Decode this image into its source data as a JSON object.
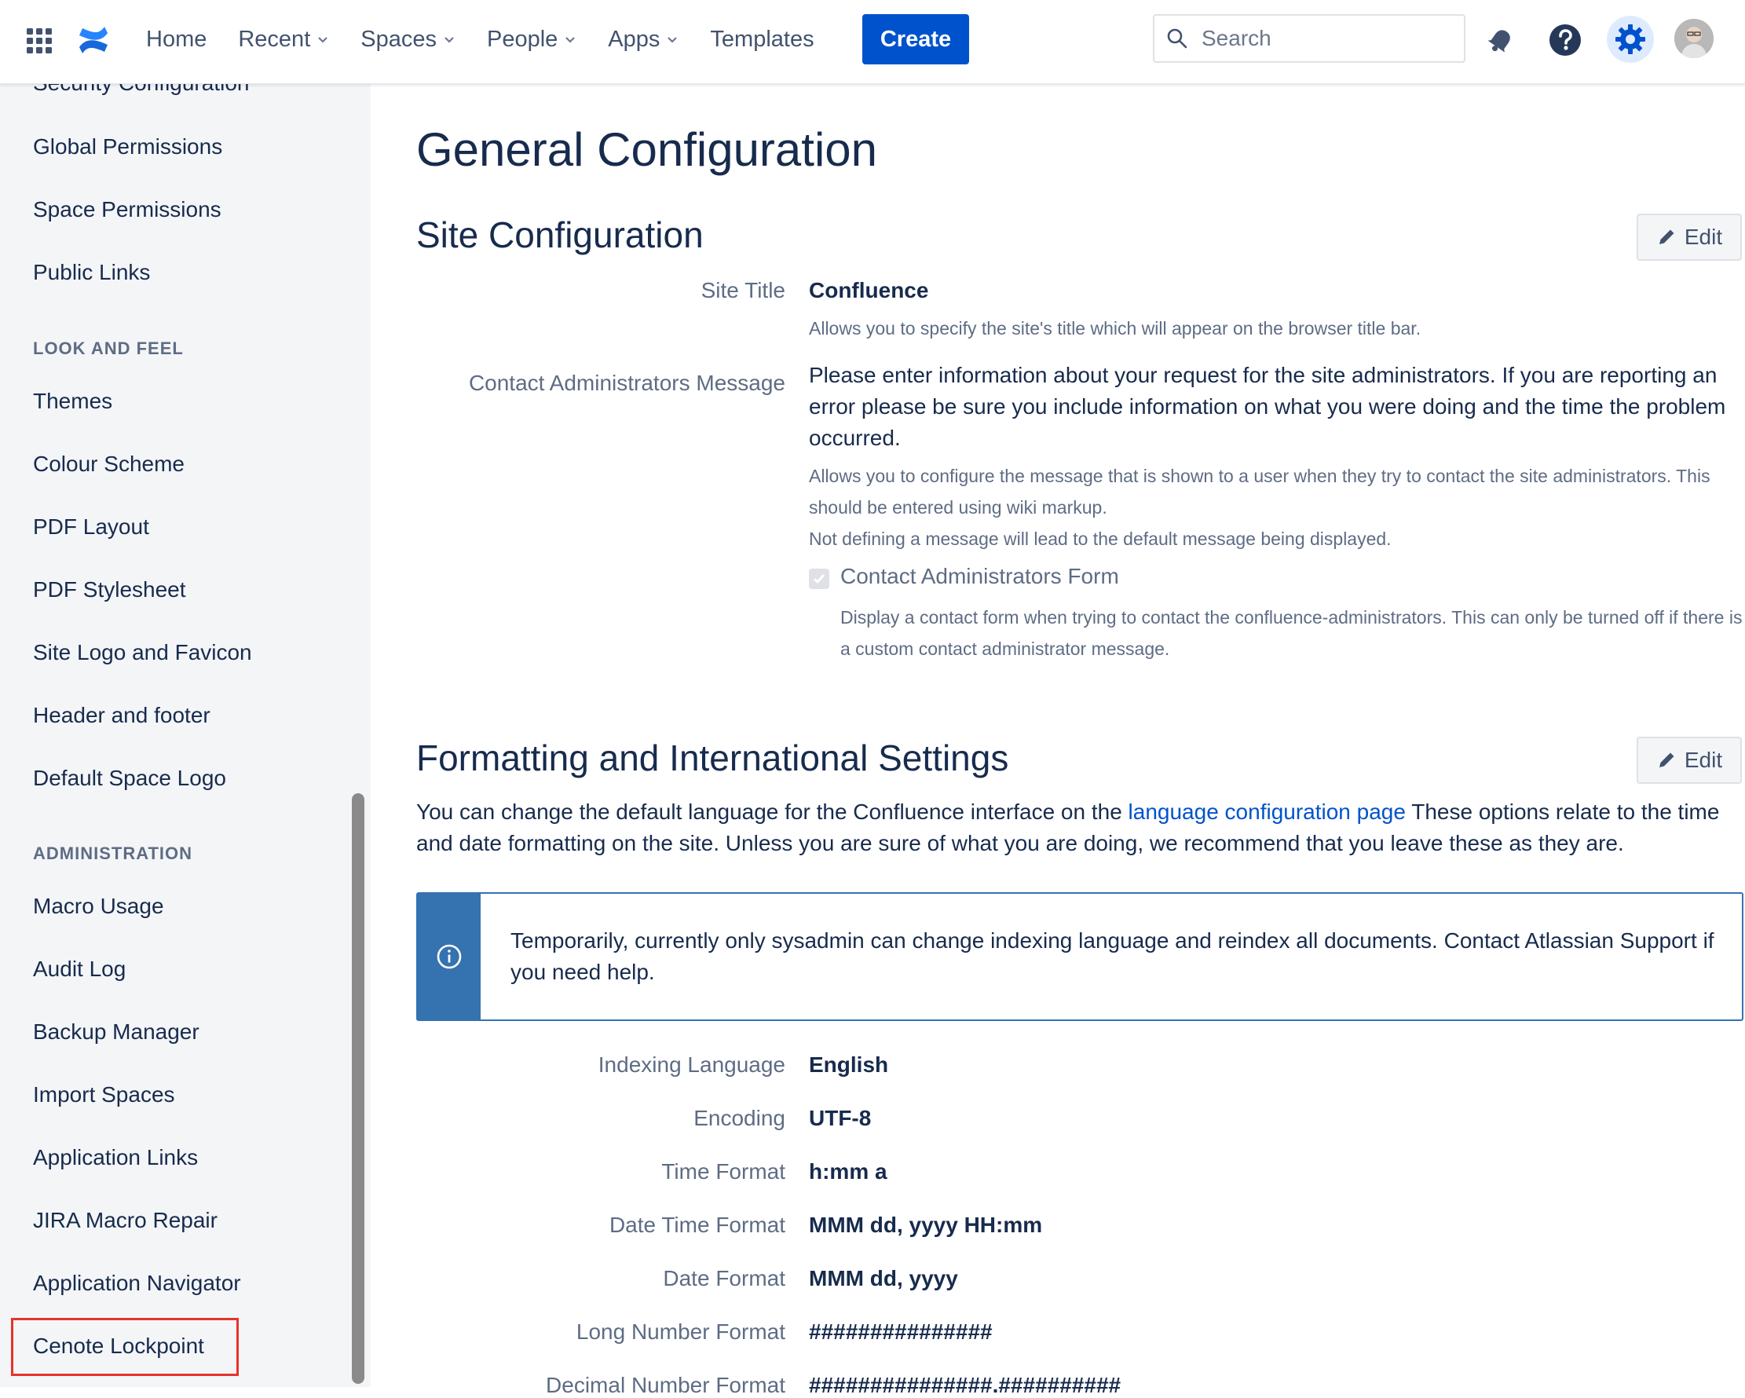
{
  "nav": {
    "items": [
      {
        "label": "Home",
        "dropdown": false
      },
      {
        "label": "Recent",
        "dropdown": true
      },
      {
        "label": "Spaces",
        "dropdown": true
      },
      {
        "label": "People",
        "dropdown": true
      },
      {
        "label": "Apps",
        "dropdown": true
      },
      {
        "label": "Templates",
        "dropdown": false
      }
    ],
    "create_label": "Create",
    "search_placeholder": "Search",
    "icons": [
      "app-grid-icon",
      "confluence-logo-icon",
      "notifications-icon",
      "help-icon",
      "settings-gear-icon",
      "search-icon"
    ]
  },
  "sidebar": {
    "items": [
      {
        "type": "item",
        "label": "Security Configuration"
      },
      {
        "type": "item",
        "label": "Global Permissions"
      },
      {
        "type": "item",
        "label": "Space Permissions"
      },
      {
        "type": "item",
        "label": "Public Links"
      },
      {
        "type": "heading",
        "label": "LOOK AND FEEL"
      },
      {
        "type": "item",
        "label": "Themes"
      },
      {
        "type": "item",
        "label": "Colour Scheme"
      },
      {
        "type": "item",
        "label": "PDF Layout"
      },
      {
        "type": "item",
        "label": "PDF Stylesheet"
      },
      {
        "type": "item",
        "label": "Site Logo and Favicon"
      },
      {
        "type": "item",
        "label": "Header and footer"
      },
      {
        "type": "item",
        "label": "Default Space Logo"
      },
      {
        "type": "heading",
        "label": "ADMINISTRATION"
      },
      {
        "type": "item",
        "label": "Macro Usage"
      },
      {
        "type": "item",
        "label": "Audit Log"
      },
      {
        "type": "item",
        "label": "Backup Manager"
      },
      {
        "type": "item",
        "label": "Import Spaces"
      },
      {
        "type": "item",
        "label": "Application Links"
      },
      {
        "type": "item",
        "label": "JIRA Macro Repair"
      },
      {
        "type": "item",
        "label": "Application Navigator"
      },
      {
        "type": "item",
        "label": "Cenote Lockpoint",
        "highlighted": true
      }
    ]
  },
  "main": {
    "page_title": "General Configuration",
    "site_config": {
      "title": "Site Configuration",
      "edit_label": "Edit",
      "site_title_label": "Site Title",
      "site_title_value": "Confluence",
      "site_title_desc": "Allows you to specify the site's title which will appear on the browser title bar.",
      "contact_label": "Contact Administrators Message",
      "contact_value": "Please enter information about your request for the site administrators. If you are reporting an error please be sure you include information on what you were doing and the time the problem occurred.",
      "contact_desc_1": "Allows you to configure the message that is shown to a user when they try to contact the site administrators. This should be entered using wiki markup.",
      "contact_desc_2": "Not defining a message will lead to the default message being displayed.",
      "form_checkbox_label": "Contact Administrators Form",
      "form_checkbox_checked": true,
      "form_desc": "Display a contact form when trying to contact the confluence-administrators. This can only be turned off if there is a custom contact administrator message."
    },
    "formatting": {
      "title": "Formatting and International Settings",
      "edit_label": "Edit",
      "intro_before": "You can change the default language for the Confluence interface on the ",
      "intro_link": "language configuration page",
      "intro_after": " These options relate to the time and date formatting on the site. Unless you are sure of what you are doing, we recommend that you leave these as they are.",
      "info_message": "Temporarily, currently only sysadmin can change indexing language and reindex all documents. Contact Atlassian Support if you need help.",
      "rows": [
        {
          "label": "Indexing Language",
          "value": "English"
        },
        {
          "label": "Encoding",
          "value": "UTF-8"
        },
        {
          "label": "Time Format",
          "value": "h:mm a"
        },
        {
          "label": "Date Time Format",
          "value": "MMM dd, yyyy HH:mm"
        },
        {
          "label": "Date Format",
          "value": "MMM dd, yyyy"
        },
        {
          "label": "Long Number Format",
          "value": "###############"
        },
        {
          "label": "Decimal Number Format",
          "value": "###############.##########"
        }
      ]
    }
  },
  "colors": {
    "primary": "#0052cc",
    "highlight": "#e5342a",
    "info": "#3572b0",
    "text": "#172b4d",
    "subtle": "#5e6c84"
  }
}
